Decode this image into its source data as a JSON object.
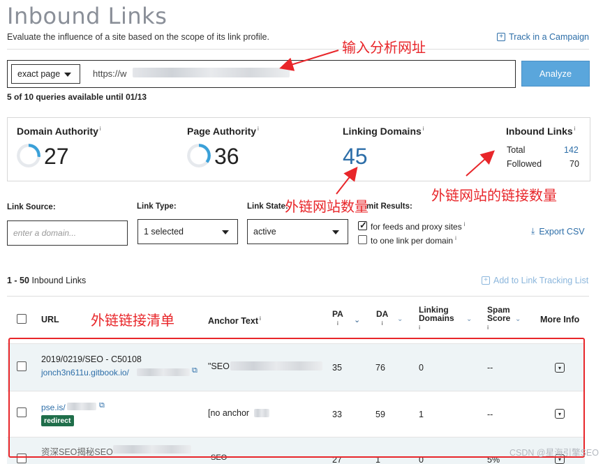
{
  "header": {
    "title": "Inbound Links",
    "subtitle": "Evaluate the influence of a site based on the scope of its link profile.",
    "track_label": "Track in a Campaign"
  },
  "search": {
    "mode": "exact page",
    "url_prefix": "https://w",
    "analyze_label": "Analyze",
    "queries_text": "5 of 10 queries available until 01/13"
  },
  "metrics": {
    "domain_authority": {
      "label": "Domain Authority",
      "info": "i",
      "value": "27",
      "score": 27
    },
    "page_authority": {
      "label": "Page Authority",
      "info": "i",
      "value": "36",
      "score": 36
    },
    "linking_domains": {
      "label": "Linking Domains",
      "info": "i",
      "value": "45"
    },
    "inbound_links": {
      "label": "Inbound Links",
      "info": "i",
      "total_label": "Total",
      "total_value": "142",
      "followed_label": "Followed",
      "followed_value": "70"
    }
  },
  "filters": {
    "link_source_label": "Link Source:",
    "link_source_placeholder": "enter a domain...",
    "link_type_label": "Link Type:",
    "link_type_value": "1 selected",
    "link_state_label": "Link State:",
    "link_state_value": "active",
    "limit_label": "mit Results:",
    "feeds_label": "for feeds and proxy sites",
    "one_link_label": "to one link per domain",
    "export_label": "Export CSV"
  },
  "list": {
    "count_range": "1 - 50",
    "count_label": "Inbound Links",
    "add_tracking_label": "Add to Link Tracking List"
  },
  "table": {
    "headers": {
      "url": "URL",
      "anchor": "Anchor Text",
      "pa": "PA",
      "da": "DA",
      "linking_domains_1": "Linking",
      "linking_domains_2": "Domains",
      "spam_1": "Spam",
      "spam_2": "Score",
      "more": "More Info",
      "info": "i"
    },
    "rows": [
      {
        "title": "2019/0219/SEO - C50108",
        "link": "jonch3n611u.gitbook.io/",
        "anchor": "\"SEO",
        "pa": "35",
        "da": "76",
        "ld": "0",
        "spam": "--"
      },
      {
        "title": "",
        "link": "pse.is/",
        "badge": "redirect",
        "anchor": "[no anchor",
        "pa": "33",
        "da": "59",
        "ld": "1",
        "spam": "--"
      },
      {
        "title": "资深SEO揭秘SEO",
        "link": "",
        "anchor": "SEO",
        "pa": "27",
        "da": "1",
        "ld": "0",
        "spam": "5%"
      }
    ]
  },
  "annotations": {
    "url_note": "输入分析网址",
    "domains_note": "外链网站数量",
    "links_note": "外链网站的链接数量",
    "list_note": "外链链接清单"
  },
  "watermark": "CSDN @星海引擎SEO",
  "colors": {
    "accent": "#2d6ea8",
    "analyze": "#5aa6dc",
    "ring": "#3aa0d8",
    "annotation": "#e8262a",
    "badge": "#1f6e4a"
  }
}
